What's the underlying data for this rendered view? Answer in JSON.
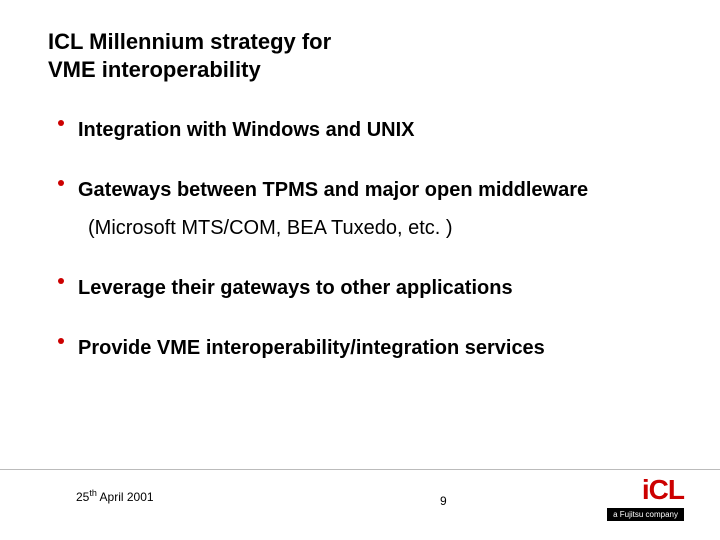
{
  "title_line1": "ICL Millennium strategy for",
  "title_line2": "VME interoperability",
  "bullets": [
    {
      "text": "Integration with Windows and UNIX"
    },
    {
      "text": "Gateways between TPMS and major open middleware"
    },
    {
      "sub": "(Microsoft MTS/COM, BEA Tuxedo, etc. )"
    },
    {
      "text": "Leverage their gateways to other applications"
    },
    {
      "text": "Provide VME interoperability/integration services"
    }
  ],
  "footer": {
    "date_day": "25",
    "date_sup": "th",
    "date_rest": " April 2001",
    "page": "9",
    "logo_text": "iCL",
    "tagline": "a Fujitsu company"
  }
}
